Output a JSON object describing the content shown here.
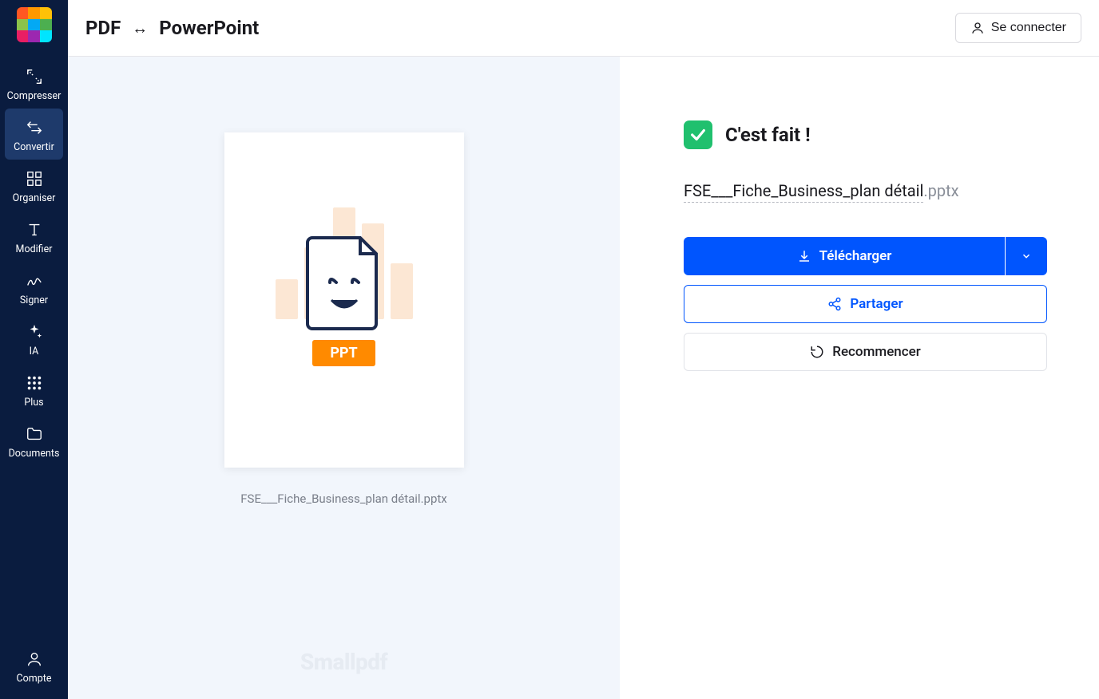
{
  "header": {
    "title_left": "PDF",
    "title_right": "PowerPoint",
    "login": "Se connecter"
  },
  "sidebar": {
    "items": [
      {
        "label": "Compresser"
      },
      {
        "label": "Convertir"
      },
      {
        "label": "Organiser"
      },
      {
        "label": "Modifier"
      },
      {
        "label": "Signer"
      },
      {
        "label": "IA"
      },
      {
        "label": "Plus"
      },
      {
        "label": "Documents"
      }
    ],
    "account": "Compte"
  },
  "preview": {
    "ppt_badge": "PPT",
    "filename": "FSE___Fiche_Business_plan détail.pptx",
    "watermark": "Smallpdf"
  },
  "result": {
    "done": "C'est fait !",
    "filename_base": "FSE___Fiche_Business_plan détail",
    "filename_ext": ".pptx",
    "download": "Télécharger",
    "share": "Partager",
    "restart": "Recommencer"
  }
}
